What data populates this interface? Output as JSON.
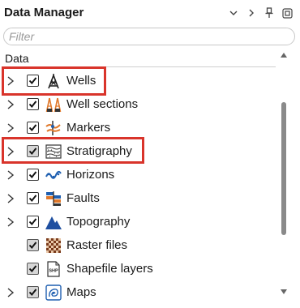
{
  "panel": {
    "title": "Data Manager",
    "buttons": [
      "chevron-down-icon",
      "chevron-right-icon",
      "pin-icon",
      "restore-window-icon"
    ]
  },
  "filter": {
    "placeholder": "Filter",
    "value": ""
  },
  "tree": {
    "column_header": "Data",
    "items": [
      {
        "label": "Wells",
        "expandable": true,
        "checked": true,
        "partial": false,
        "icon": "well-derrick-icon",
        "highlighted": true
      },
      {
        "label": "Well sections",
        "expandable": true,
        "checked": true,
        "partial": false,
        "icon": "well-sections-icon",
        "highlighted": false
      },
      {
        "label": "Markers",
        "expandable": true,
        "checked": true,
        "partial": false,
        "icon": "markers-icon",
        "highlighted": false
      },
      {
        "label": "Stratigraphy",
        "expandable": true,
        "checked": true,
        "partial": true,
        "icon": "stratigraphy-icon",
        "highlighted": true
      },
      {
        "label": "Horizons",
        "expandable": true,
        "checked": true,
        "partial": false,
        "icon": "horizons-icon",
        "highlighted": false
      },
      {
        "label": "Faults",
        "expandable": true,
        "checked": true,
        "partial": false,
        "icon": "faults-icon",
        "highlighted": false
      },
      {
        "label": "Topography",
        "expandable": true,
        "checked": true,
        "partial": false,
        "icon": "topography-icon",
        "highlighted": false
      },
      {
        "label": "Raster files",
        "expandable": false,
        "checked": true,
        "partial": true,
        "icon": "raster-files-icon",
        "highlighted": false
      },
      {
        "label": "Shapefile layers",
        "expandable": false,
        "checked": true,
        "partial": true,
        "icon": "shapefile-icon",
        "highlighted": false,
        "icon_text": "SHP"
      },
      {
        "label": "Maps",
        "expandable": true,
        "checked": true,
        "partial": true,
        "icon": "maps-icon",
        "highlighted": false
      }
    ]
  },
  "colors": {
    "highlight": "#d9342b",
    "accent_blue": "#1f5fb0",
    "accent_orange": "#e0782a"
  }
}
